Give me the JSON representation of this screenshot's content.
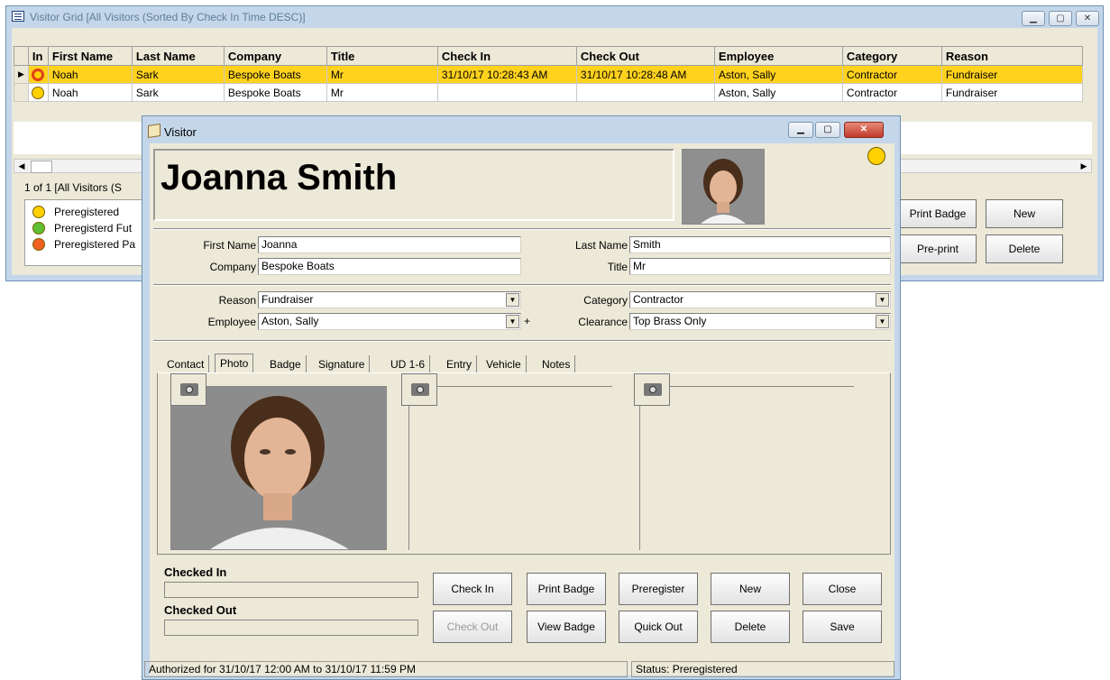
{
  "grid_window": {
    "title": "Visitor Grid  [All Visitors (Sorted By Check In Time DESC)]",
    "columns": [
      "In",
      "First Name",
      "Last Name",
      "Company",
      "Title",
      "Check In",
      "Check Out",
      "Employee",
      "Category",
      "Reason"
    ],
    "rows": [
      {
        "first": "Noah",
        "last": "Sark",
        "company": "Bespoke Boats",
        "title": "Mr",
        "check_in": "31/10/17 10:28:43 AM",
        "check_out": "31/10/17 10:28:48 AM",
        "employee": "Aston, Sally",
        "category": "Contractor",
        "reason": "Fundraiser"
      },
      {
        "first": "Noah",
        "last": "Sark",
        "company": "Bespoke Boats",
        "title": "Mr",
        "check_in": "",
        "check_out": "",
        "employee": "Aston, Sally",
        "category": "Contractor",
        "reason": "Fundraiser"
      }
    ],
    "status": "1 of 1 [All Visitors (S",
    "legend": [
      "Preregistered",
      "Preregisterd Fut",
      "Preregistered Pa"
    ],
    "buttons": {
      "print_badge": "Print Badge",
      "new": "New",
      "pre_print": "Pre-print",
      "delete": "Delete"
    }
  },
  "visitor_dialog": {
    "title": "Visitor",
    "full_name": "Joanna Smith",
    "fields": {
      "first_name_label": "First Name",
      "first_name": "Joanna",
      "last_name_label": "Last Name",
      "last_name": "Smith",
      "company_label": "Company",
      "company": "Bespoke Boats",
      "title_label": "Title",
      "title": "Mr",
      "reason_label": "Reason",
      "reason": "Fundraiser",
      "category_label": "Category",
      "category": "Contractor",
      "employee_label": "Employee",
      "employee": "Aston, Sally",
      "clearance_label": "Clearance",
      "clearance": "Top Brass Only"
    },
    "tabs": [
      "Contact",
      "Photo",
      "Badge",
      "Signature",
      "UD 1-6",
      "Entry",
      "Vehicle",
      "Notes"
    ],
    "active_tab": "Photo",
    "checked_in_label": "Checked In",
    "checked_out_label": "Checked Out",
    "buttons": {
      "check_in": "Check In",
      "print_badge": "Print Badge",
      "preregister": "Preregister",
      "new": "New",
      "close": "Close",
      "check_out": "Check Out",
      "view_badge": "View Badge",
      "quick_out": "Quick Out",
      "delete": "Delete",
      "save": "Save"
    },
    "status_authorized": "Authorized for 31/10/17 12:00 AM to 31/10/17 11:59 PM",
    "status_state": "Status: Preregistered"
  },
  "colors": {
    "selected_row": "#ffd21e",
    "title_bar": "#c4d7ea",
    "status_dot": "#ffd100"
  }
}
